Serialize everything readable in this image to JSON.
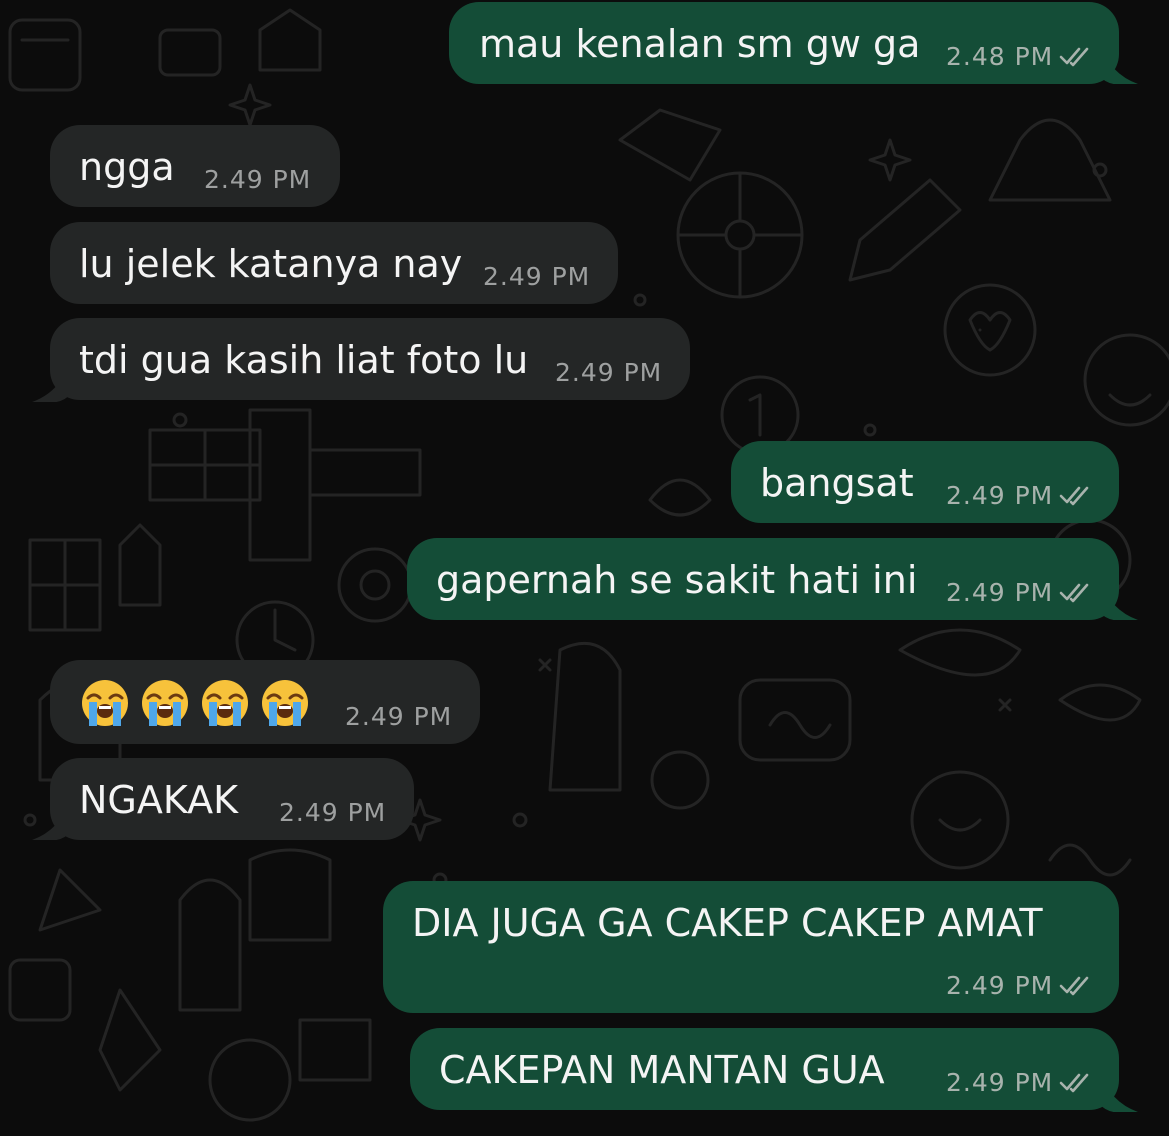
{
  "conversation": {
    "messages": [
      {
        "id": "m1",
        "direction": "outgoing",
        "text": "mau kenalan sm gw ga",
        "time": "2.48 PM",
        "status": "read"
      },
      {
        "id": "m2",
        "direction": "incoming",
        "text": "ngga",
        "time": "2.49 PM"
      },
      {
        "id": "m3",
        "direction": "incoming",
        "text": "lu jelek katanya nay",
        "time": "2.49 PM"
      },
      {
        "id": "m4",
        "direction": "incoming",
        "text": "tdi gua kasih liat foto lu",
        "time": "2.49 PM"
      },
      {
        "id": "m5",
        "direction": "outgoing",
        "text": "bangsat",
        "time": "2.49 PM",
        "status": "read"
      },
      {
        "id": "m6",
        "direction": "outgoing",
        "text": "gapernah se sakit hati ini",
        "time": "2.49 PM",
        "status": "read"
      },
      {
        "id": "m7",
        "direction": "incoming",
        "text": "😭😭😭😭",
        "emoji": [
          "loudly-crying-face",
          "loudly-crying-face",
          "loudly-crying-face",
          "loudly-crying-face"
        ],
        "time": "2.49 PM"
      },
      {
        "id": "m8",
        "direction": "incoming",
        "text": "NGAKAK",
        "time": "2.49 PM"
      },
      {
        "id": "m9",
        "direction": "outgoing",
        "text": "DIA JUGA GA CAKEP CAKEP AMAT",
        "time": "2.49 PM",
        "status": "read"
      },
      {
        "id": "m10",
        "direction": "outgoing",
        "text": "CAKEPAN MANTAN GUA",
        "time": "2.49 PM",
        "status": "read"
      }
    ]
  },
  "theme": {
    "background": "#0c0c0c",
    "incoming_bubble": "#242626",
    "outgoing_bubble": "#144d37",
    "text": "#f4f4f4",
    "meta_text": "#a8b3ad",
    "ticks_icon": "double-check-icon"
  }
}
